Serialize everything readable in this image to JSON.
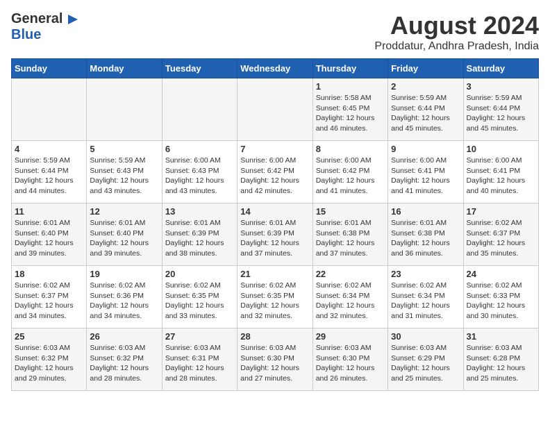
{
  "logo": {
    "general": "General",
    "blue": "Blue",
    "icon": "▶"
  },
  "title": "August 2024",
  "subtitle": "Proddatur, Andhra Pradesh, India",
  "days_of_week": [
    "Sunday",
    "Monday",
    "Tuesday",
    "Wednesday",
    "Thursday",
    "Friday",
    "Saturday"
  ],
  "weeks": [
    [
      {
        "num": "",
        "detail": ""
      },
      {
        "num": "",
        "detail": ""
      },
      {
        "num": "",
        "detail": ""
      },
      {
        "num": "",
        "detail": ""
      },
      {
        "num": "1",
        "detail": "Sunrise: 5:58 AM\nSunset: 6:45 PM\nDaylight: 12 hours\nand 46 minutes."
      },
      {
        "num": "2",
        "detail": "Sunrise: 5:59 AM\nSunset: 6:44 PM\nDaylight: 12 hours\nand 45 minutes."
      },
      {
        "num": "3",
        "detail": "Sunrise: 5:59 AM\nSunset: 6:44 PM\nDaylight: 12 hours\nand 45 minutes."
      }
    ],
    [
      {
        "num": "4",
        "detail": "Sunrise: 5:59 AM\nSunset: 6:44 PM\nDaylight: 12 hours\nand 44 minutes."
      },
      {
        "num": "5",
        "detail": "Sunrise: 5:59 AM\nSunset: 6:43 PM\nDaylight: 12 hours\nand 43 minutes."
      },
      {
        "num": "6",
        "detail": "Sunrise: 6:00 AM\nSunset: 6:43 PM\nDaylight: 12 hours\nand 43 minutes."
      },
      {
        "num": "7",
        "detail": "Sunrise: 6:00 AM\nSunset: 6:42 PM\nDaylight: 12 hours\nand 42 minutes."
      },
      {
        "num": "8",
        "detail": "Sunrise: 6:00 AM\nSunset: 6:42 PM\nDaylight: 12 hours\nand 41 minutes."
      },
      {
        "num": "9",
        "detail": "Sunrise: 6:00 AM\nSunset: 6:41 PM\nDaylight: 12 hours\nand 41 minutes."
      },
      {
        "num": "10",
        "detail": "Sunrise: 6:00 AM\nSunset: 6:41 PM\nDaylight: 12 hours\nand 40 minutes."
      }
    ],
    [
      {
        "num": "11",
        "detail": "Sunrise: 6:01 AM\nSunset: 6:40 PM\nDaylight: 12 hours\nand 39 minutes."
      },
      {
        "num": "12",
        "detail": "Sunrise: 6:01 AM\nSunset: 6:40 PM\nDaylight: 12 hours\nand 39 minutes."
      },
      {
        "num": "13",
        "detail": "Sunrise: 6:01 AM\nSunset: 6:39 PM\nDaylight: 12 hours\nand 38 minutes."
      },
      {
        "num": "14",
        "detail": "Sunrise: 6:01 AM\nSunset: 6:39 PM\nDaylight: 12 hours\nand 37 minutes."
      },
      {
        "num": "15",
        "detail": "Sunrise: 6:01 AM\nSunset: 6:38 PM\nDaylight: 12 hours\nand 37 minutes."
      },
      {
        "num": "16",
        "detail": "Sunrise: 6:01 AM\nSunset: 6:38 PM\nDaylight: 12 hours\nand 36 minutes."
      },
      {
        "num": "17",
        "detail": "Sunrise: 6:02 AM\nSunset: 6:37 PM\nDaylight: 12 hours\nand 35 minutes."
      }
    ],
    [
      {
        "num": "18",
        "detail": "Sunrise: 6:02 AM\nSunset: 6:37 PM\nDaylight: 12 hours\nand 34 minutes."
      },
      {
        "num": "19",
        "detail": "Sunrise: 6:02 AM\nSunset: 6:36 PM\nDaylight: 12 hours\nand 34 minutes."
      },
      {
        "num": "20",
        "detail": "Sunrise: 6:02 AM\nSunset: 6:35 PM\nDaylight: 12 hours\nand 33 minutes."
      },
      {
        "num": "21",
        "detail": "Sunrise: 6:02 AM\nSunset: 6:35 PM\nDaylight: 12 hours\nand 32 minutes."
      },
      {
        "num": "22",
        "detail": "Sunrise: 6:02 AM\nSunset: 6:34 PM\nDaylight: 12 hours\nand 32 minutes."
      },
      {
        "num": "23",
        "detail": "Sunrise: 6:02 AM\nSunset: 6:34 PM\nDaylight: 12 hours\nand 31 minutes."
      },
      {
        "num": "24",
        "detail": "Sunrise: 6:02 AM\nSunset: 6:33 PM\nDaylight: 12 hours\nand 30 minutes."
      }
    ],
    [
      {
        "num": "25",
        "detail": "Sunrise: 6:03 AM\nSunset: 6:32 PM\nDaylight: 12 hours\nand 29 minutes."
      },
      {
        "num": "26",
        "detail": "Sunrise: 6:03 AM\nSunset: 6:32 PM\nDaylight: 12 hours\nand 28 minutes."
      },
      {
        "num": "27",
        "detail": "Sunrise: 6:03 AM\nSunset: 6:31 PM\nDaylight: 12 hours\nand 28 minutes."
      },
      {
        "num": "28",
        "detail": "Sunrise: 6:03 AM\nSunset: 6:30 PM\nDaylight: 12 hours\nand 27 minutes."
      },
      {
        "num": "29",
        "detail": "Sunrise: 6:03 AM\nSunset: 6:30 PM\nDaylight: 12 hours\nand 26 minutes."
      },
      {
        "num": "30",
        "detail": "Sunrise: 6:03 AM\nSunset: 6:29 PM\nDaylight: 12 hours\nand 25 minutes."
      },
      {
        "num": "31",
        "detail": "Sunrise: 6:03 AM\nSunset: 6:28 PM\nDaylight: 12 hours\nand 25 minutes."
      }
    ]
  ]
}
